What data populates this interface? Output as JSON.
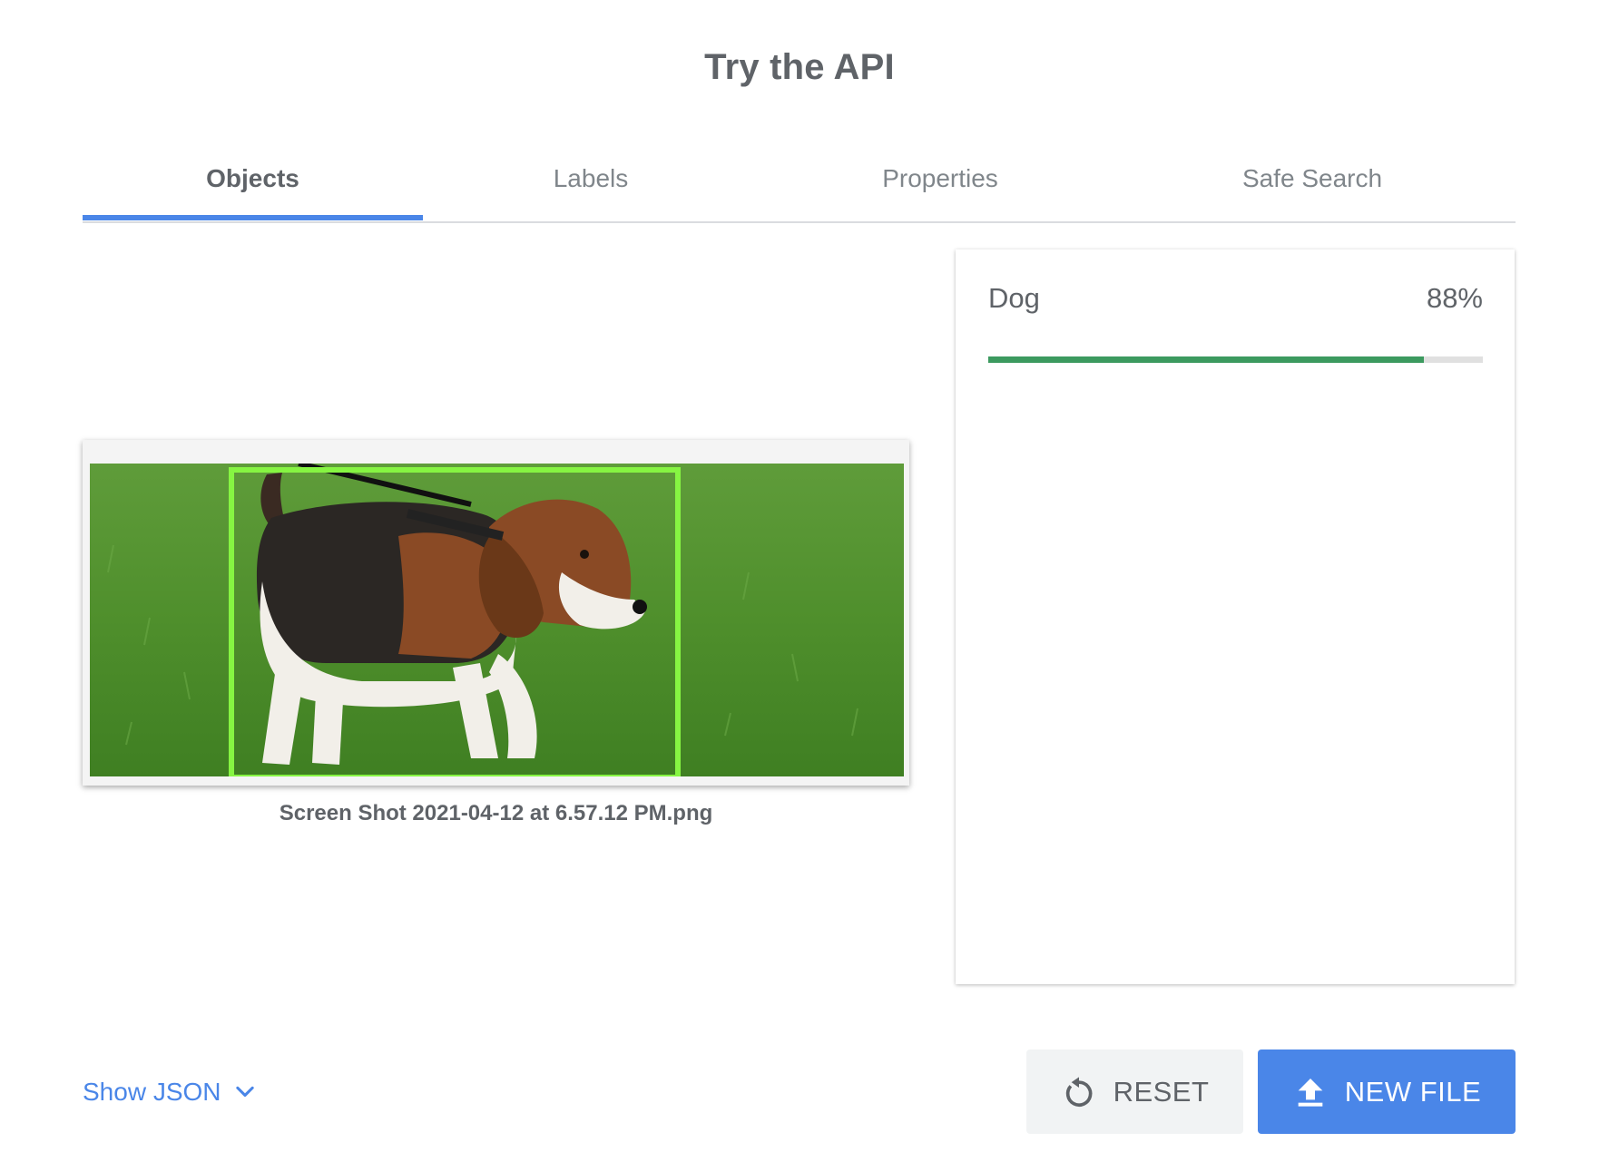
{
  "page": {
    "title": "Try the API"
  },
  "tabs": [
    {
      "label": "Objects",
      "active": true
    },
    {
      "label": "Labels",
      "active": false
    },
    {
      "label": "Properties",
      "active": false
    },
    {
      "label": "Safe Search",
      "active": false
    }
  ],
  "preview": {
    "filename": "Screen Shot 2021-04-12 at 6.57.12 PM.png"
  },
  "results": [
    {
      "label": "Dog",
      "score_text": "88%",
      "score": 0.88
    }
  ],
  "footer": {
    "show_json_label": "Show JSON",
    "reset_label": "RESET",
    "new_file_label": "NEW FILE"
  },
  "colors": {
    "accent": "#4a86e8",
    "bbox": "#86f542",
    "score_bar": "#3c9a5f",
    "text": "#5f6368"
  },
  "icons": {
    "reset": "reset-icon",
    "upload": "upload-icon",
    "chevron": "chevron-down-icon"
  }
}
